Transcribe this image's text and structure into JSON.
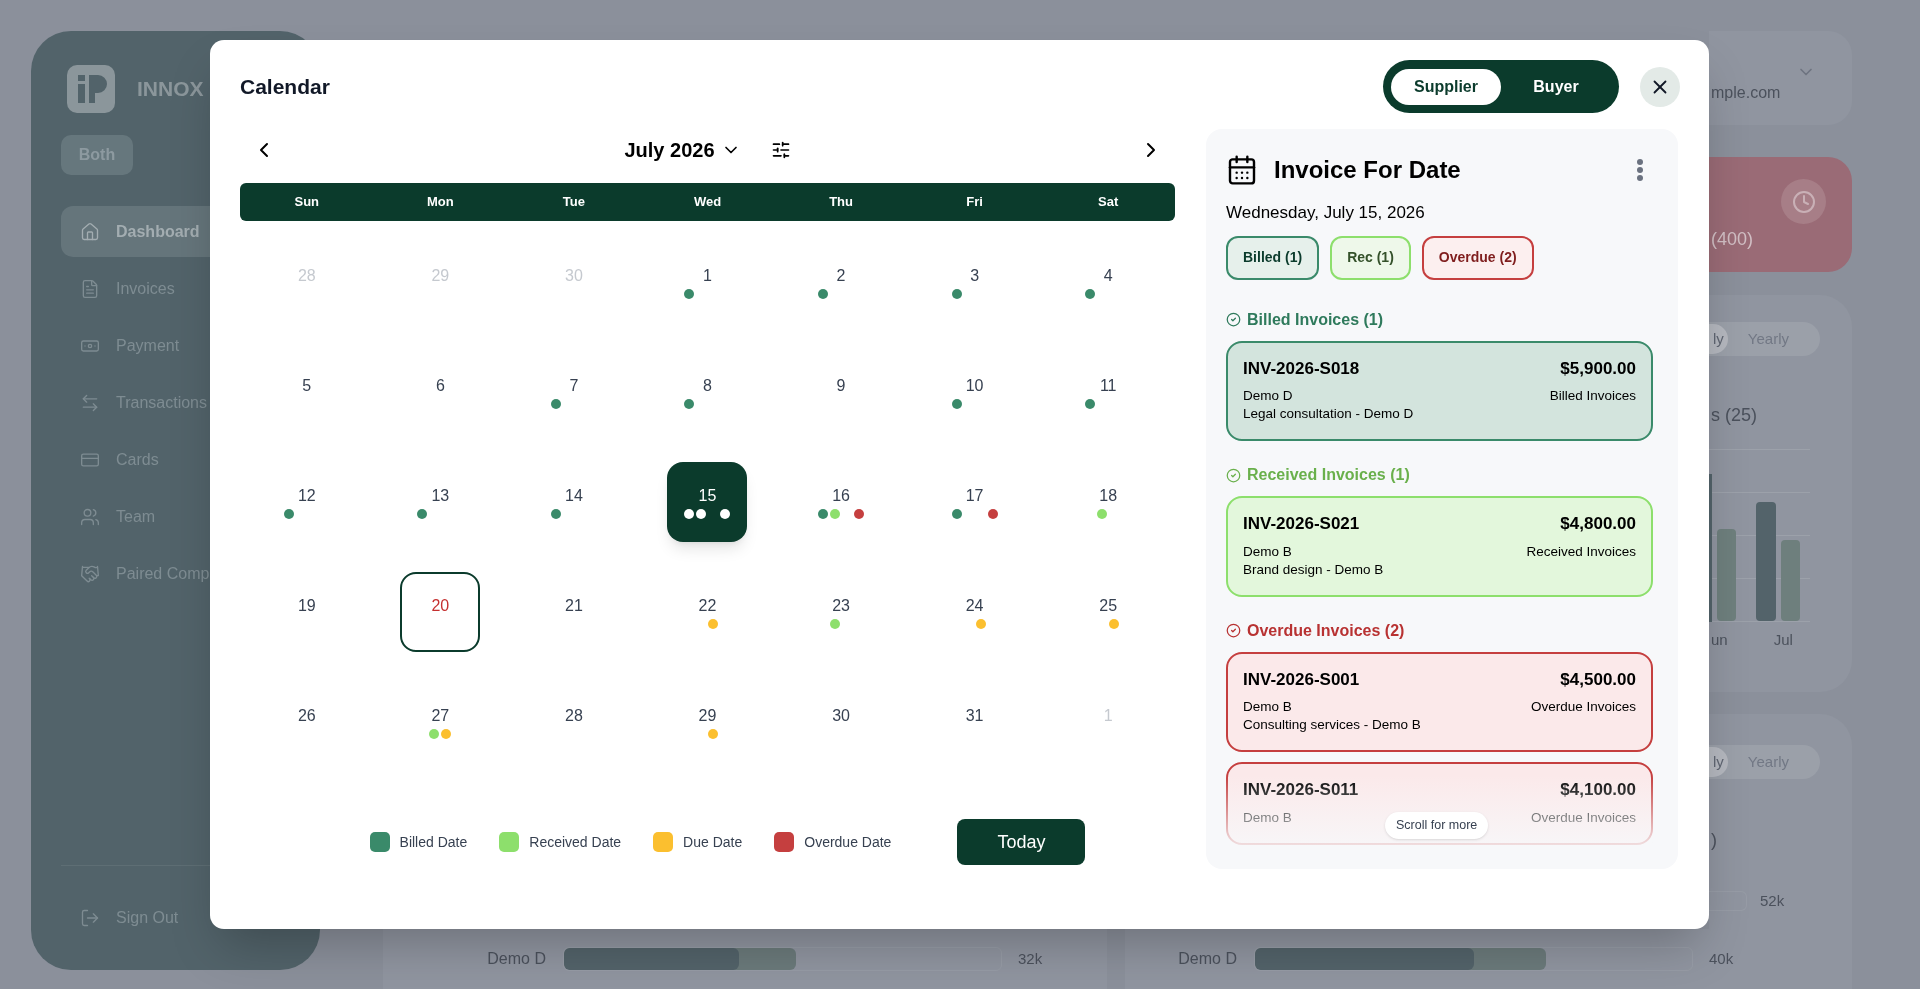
{
  "background": {
    "brand": "INNOX",
    "role_badge": "Both",
    "nav": [
      {
        "label": "Dashboard",
        "selected": true
      },
      {
        "label": "Invoices",
        "selected": false
      },
      {
        "label": "Payment",
        "selected": false
      },
      {
        "label": "Transactions",
        "selected": false
      },
      {
        "label": "Cards",
        "selected": false
      },
      {
        "label": "Team",
        "selected": false
      },
      {
        "label": "Paired Comp",
        "selected": false
      }
    ],
    "sign_out": "Sign Out",
    "account_email": "mple.com",
    "alert_count": "(400)",
    "chart_card": {
      "toggle": [
        {
          "label": "ly",
          "selected": true
        },
        {
          "label": "Yearly",
          "selected": false
        }
      ],
      "subtitle": "s (25)",
      "months": [
        "un",
        "Jul"
      ]
    },
    "ranking_card": {
      "toggle": [
        {
          "label": "ly",
          "selected": true
        },
        {
          "label": "Yearly",
          "selected": false
        }
      ],
      "subtitle": ")",
      "value": "52k"
    },
    "rows": [
      {
        "label": "Demo D",
        "value": "32k",
        "bars": [
          {
            "level": 0.53
          },
          {
            "level": 0.4
          }
        ]
      },
      {
        "label": "Demo D",
        "value": "40k",
        "bars": [
          {
            "level": 0.665
          },
          {
            "level": 0.5
          }
        ]
      }
    ]
  },
  "modal": {
    "title": "Calendar",
    "modes": [
      {
        "label": "Supplier",
        "selected": true
      },
      {
        "label": "Buyer",
        "selected": false
      }
    ],
    "calendar": {
      "month": "July 2026",
      "weekdays": [
        "Sun",
        "Mon",
        "Tue",
        "Wed",
        "Thu",
        "Fri",
        "Sat"
      ],
      "days": [
        {
          "label": "28",
          "in_month": false,
          "selected": false,
          "today": false
        },
        {
          "label": "29",
          "in_month": false,
          "selected": false,
          "today": false
        },
        {
          "label": "30",
          "in_month": false,
          "selected": false,
          "today": false
        },
        {
          "label": "1",
          "in_month": true,
          "selected": false,
          "today": false,
          "dots": [
            {
              "kind": "billed"
            }
          ]
        },
        {
          "label": "2",
          "in_month": true,
          "selected": false,
          "today": false,
          "dots": [
            {
              "kind": "billed"
            }
          ]
        },
        {
          "label": "3",
          "in_month": true,
          "selected": false,
          "today": false,
          "dots": [
            {
              "kind": "billed"
            }
          ]
        },
        {
          "label": "4",
          "in_month": true,
          "selected": false,
          "today": false,
          "dots": [
            {
              "kind": "billed"
            }
          ]
        },
        {
          "label": "5",
          "in_month": true,
          "selected": false,
          "today": false
        },
        {
          "label": "6",
          "in_month": true,
          "selected": false,
          "today": false
        },
        {
          "label": "7",
          "in_month": true,
          "selected": false,
          "today": false,
          "dots": [
            {
              "kind": "billed"
            }
          ]
        },
        {
          "label": "8",
          "in_month": true,
          "selected": false,
          "today": false,
          "dots": [
            {
              "kind": "billed"
            }
          ]
        },
        {
          "label": "9",
          "in_month": true,
          "selected": false,
          "today": false
        },
        {
          "label": "10",
          "in_month": true,
          "selected": false,
          "today": false,
          "dots": [
            {
              "kind": "billed"
            }
          ]
        },
        {
          "label": "11",
          "in_month": true,
          "selected": false,
          "today": false,
          "dots": [
            {
              "kind": "billed"
            }
          ]
        },
        {
          "label": "12",
          "in_month": true,
          "selected": false,
          "today": false,
          "dots": [
            {
              "kind": "billed"
            }
          ]
        },
        {
          "label": "13",
          "in_month": true,
          "selected": false,
          "today": false,
          "dots": [
            {
              "kind": "billed"
            }
          ]
        },
        {
          "label": "14",
          "in_month": true,
          "selected": false,
          "today": false,
          "dots": [
            {
              "kind": "billed"
            }
          ]
        },
        {
          "label": "15",
          "in_month": true,
          "selected": true,
          "today": false,
          "dots": [
            {
              "kind": "billed"
            },
            {
              "kind": "received"
            },
            {
              "kind": "overdue"
            }
          ]
        },
        {
          "label": "16",
          "in_month": true,
          "selected": false,
          "today": false,
          "dots": [
            {
              "kind": "billed"
            },
            {
              "kind": "received"
            },
            {
              "kind": "overdue"
            }
          ]
        },
        {
          "label": "17",
          "in_month": true,
          "selected": false,
          "today": false,
          "dots": [
            {
              "kind": "billed"
            },
            {
              "kind": "overdue"
            }
          ]
        },
        {
          "label": "18",
          "in_month": true,
          "selected": false,
          "today": false,
          "dots": [
            {
              "kind": "received"
            }
          ]
        },
        {
          "label": "19",
          "in_month": true,
          "selected": false,
          "today": false
        },
        {
          "label": "20",
          "in_month": true,
          "selected": false,
          "today": true
        },
        {
          "label": "21",
          "in_month": true,
          "selected": false,
          "today": false
        },
        {
          "label": "22",
          "in_month": true,
          "selected": false,
          "today": false,
          "dots": [
            {
              "kind": "due"
            }
          ]
        },
        {
          "label": "23",
          "in_month": true,
          "selected": false,
          "today": false,
          "dots": [
            {
              "kind": "received"
            }
          ]
        },
        {
          "label": "24",
          "in_month": true,
          "selected": false,
          "today": false,
          "dots": [
            {
              "kind": "due"
            }
          ]
        },
        {
          "label": "25",
          "in_month": true,
          "selected": false,
          "today": false,
          "dots": [
            {
              "kind": "due"
            }
          ]
        },
        {
          "label": "26",
          "in_month": true,
          "selected": false,
          "today": false
        },
        {
          "label": "27",
          "in_month": true,
          "selected": false,
          "today": false,
          "dots": [
            {
              "kind": "received"
            },
            {
              "kind": "due"
            }
          ]
        },
        {
          "label": "28",
          "in_month": true,
          "selected": false,
          "today": false
        },
        {
          "label": "29",
          "in_month": true,
          "selected": false,
          "today": false,
          "dots": [
            {
              "kind": "due"
            }
          ]
        },
        {
          "label": "30",
          "in_month": true,
          "selected": false,
          "today": false
        },
        {
          "label": "31",
          "in_month": true,
          "selected": false,
          "today": false
        },
        {
          "label": "1",
          "in_month": false,
          "selected": false,
          "today": false
        }
      ]
    },
    "legend": [
      {
        "kind": "billed",
        "label": "Billed Date",
        "color": "#3a8a6a"
      },
      {
        "kind": "received",
        "label": "Received Date",
        "color": "#8ddf6c"
      },
      {
        "kind": "due",
        "label": "Due Date",
        "color": "#fbbf2f"
      },
      {
        "kind": "overdue",
        "label": "Overdue Date",
        "color": "#c53f3f"
      }
    ],
    "today_button": "Today",
    "panel": {
      "title": "Invoice For Date",
      "date": "Wednesday, July 15, 2026",
      "filters": [
        {
          "kind": "billed",
          "label": "Billed (1)"
        },
        {
          "kind": "received",
          "label": "Rec (1)"
        },
        {
          "kind": "overdue",
          "label": "Overdue (2)"
        }
      ],
      "sections": [
        {
          "kind": "billed",
          "title": "Billed Invoices (1)",
          "invoices": [
            {
              "id": "INV-2026-S018",
              "amount": "$5,900.00",
              "company": "Demo D",
              "category": "Billed Invoices",
              "description": "Legal consultation - Demo D"
            }
          ]
        },
        {
          "kind": "received",
          "title": "Received Invoices (1)",
          "invoices": [
            {
              "id": "INV-2026-S021",
              "amount": "$4,800.00",
              "company": "Demo B",
              "category": "Received Invoices",
              "description": "Brand design - Demo B"
            }
          ]
        },
        {
          "kind": "overdue",
          "title": "Overdue Invoices (2)",
          "invoices": [
            {
              "id": "INV-2026-S001",
              "amount": "$4,500.00",
              "company": "Demo B",
              "category": "Overdue Invoices",
              "description": "Consulting services - Demo B"
            },
            {
              "id": "INV-2026-S011",
              "amount": "$4,100.00",
              "company": "Demo B",
              "category": "Overdue Invoices"
            }
          ]
        }
      ],
      "scroll_hint": "Scroll for more"
    }
  }
}
